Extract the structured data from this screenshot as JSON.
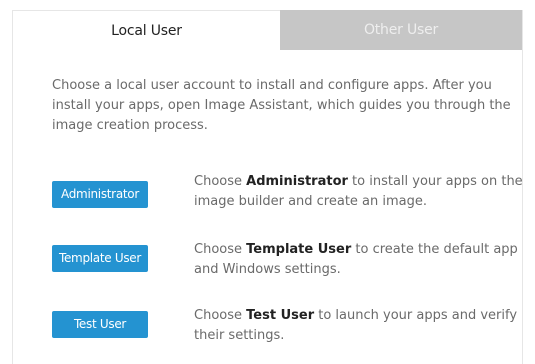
{
  "tabs": [
    {
      "label": "Local User",
      "active": true
    },
    {
      "label": "Other User",
      "active": false
    }
  ],
  "intro": "Choose a local user account to install and configure apps. After you install your apps, open Image Assistant, which guides you through the image creation process.",
  "accounts": [
    {
      "button_label": "Administrator",
      "desc_prefix": "Choose ",
      "desc_bold": "Administrator",
      "desc_suffix": " to install your apps on the image builder and create an image."
    },
    {
      "button_label": "Template User",
      "desc_prefix": "Choose ",
      "desc_bold": "Template User",
      "desc_suffix": " to create the default app and Windows settings."
    },
    {
      "button_label": "Test User",
      "desc_prefix": "Choose ",
      "desc_bold": "Test User",
      "desc_suffix": " to launch your apps and verify their settings."
    }
  ],
  "colors": {
    "button_blue": "#2493d1",
    "inactive_tab": "#c6c6c6",
    "body_text": "#6a6a6a"
  }
}
